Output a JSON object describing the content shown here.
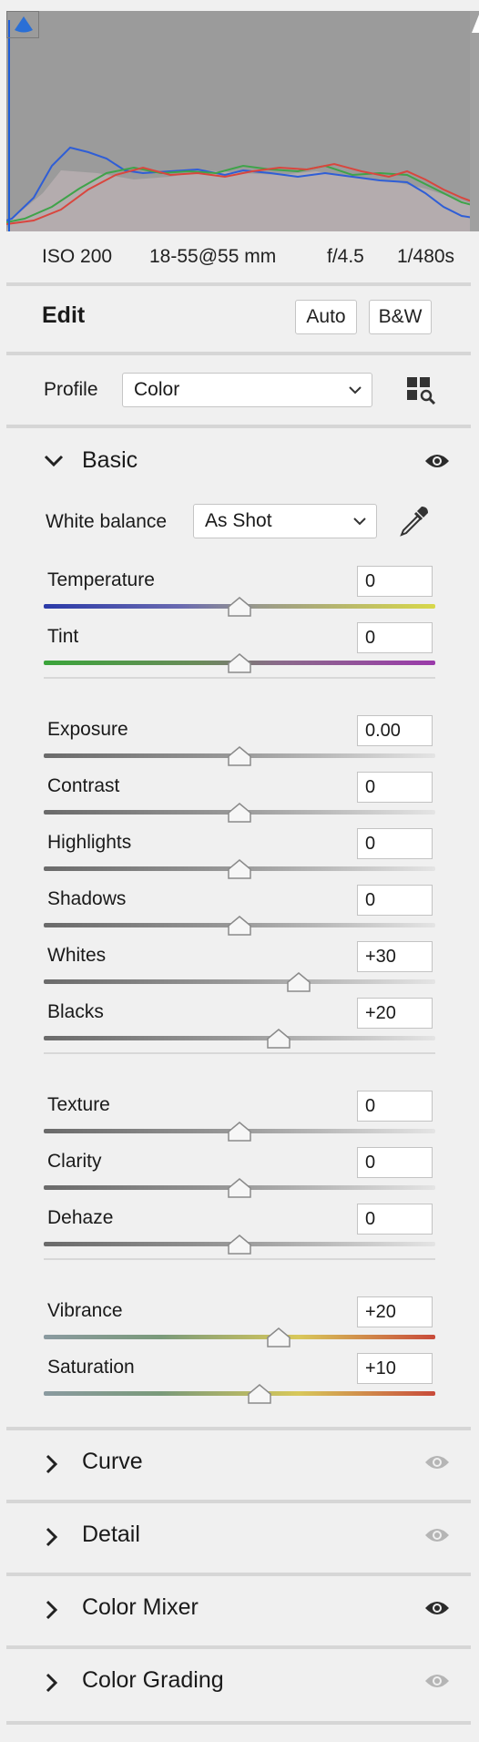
{
  "camera": {
    "iso": "ISO 200",
    "lens": "18-55@55 mm",
    "aperture": "f/4.5",
    "shutter": "1/480s"
  },
  "edit": {
    "title": "Edit",
    "auto_label": "Auto",
    "bw_label": "B&W"
  },
  "profile": {
    "label": "Profile",
    "value": "Color"
  },
  "basic": {
    "title": "Basic",
    "white_balance_label": "White balance",
    "white_balance_value": "As Shot",
    "groups": [
      [
        {
          "key": "temperature",
          "label": "Temperature",
          "value": "0",
          "level": 0,
          "track": "temp"
        },
        {
          "key": "tint",
          "label": "Tint",
          "value": "0",
          "level": 0,
          "track": "tint"
        }
      ],
      [
        {
          "key": "exposure",
          "label": "Exposure",
          "value": "0.00",
          "level": 0,
          "track": "gray"
        },
        {
          "key": "contrast",
          "label": "Contrast",
          "value": "0",
          "level": 0,
          "track": "gray"
        },
        {
          "key": "highlights",
          "label": "Highlights",
          "value": "0",
          "level": 0,
          "track": "gray"
        },
        {
          "key": "shadows",
          "label": "Shadows",
          "value": "0",
          "level": 0,
          "track": "gray"
        },
        {
          "key": "whites",
          "label": "Whites",
          "value": "+30",
          "level": 30,
          "track": "gray"
        },
        {
          "key": "blacks",
          "label": "Blacks",
          "value": "+20",
          "level": 20,
          "track": "gray"
        }
      ],
      [
        {
          "key": "texture",
          "label": "Texture",
          "value": "0",
          "level": 0,
          "track": "gray"
        },
        {
          "key": "clarity",
          "label": "Clarity",
          "value": "0",
          "level": 0,
          "track": "gray"
        },
        {
          "key": "dehaze",
          "label": "Dehaze",
          "value": "0",
          "level": 0,
          "track": "gray"
        }
      ],
      [
        {
          "key": "vibrance",
          "label": "Vibrance",
          "value": "+20",
          "level": 20,
          "track": "color"
        },
        {
          "key": "saturation",
          "label": "Saturation",
          "value": "+10",
          "level": 10,
          "track": "color"
        }
      ]
    ]
  },
  "sections": [
    {
      "key": "curve",
      "title": "Curve",
      "eye_active": false
    },
    {
      "key": "detail",
      "title": "Detail",
      "eye_active": false
    },
    {
      "key": "color-mixer",
      "title": "Color Mixer",
      "eye_active": true
    },
    {
      "key": "color-grading",
      "title": "Color Grading",
      "eye_active": false
    }
  ],
  "icons": {
    "clipping_shadow": "triangle-icon",
    "clipping_highlight": "triangle-icon",
    "browse_profiles": "profile-browser-icon",
    "eyedropper": "eyedropper-icon",
    "visibility": "eye-icon",
    "expand": "chevron-right-icon",
    "collapse": "chevron-down-icon",
    "dropdown": "chevron-down-icon"
  },
  "colors": {
    "histogram_bg": "#9b9b9b",
    "panel_bg": "#f0f0f0",
    "eye_active": "#2b2b2b",
    "eye_inactive": "#b5b5b5"
  }
}
